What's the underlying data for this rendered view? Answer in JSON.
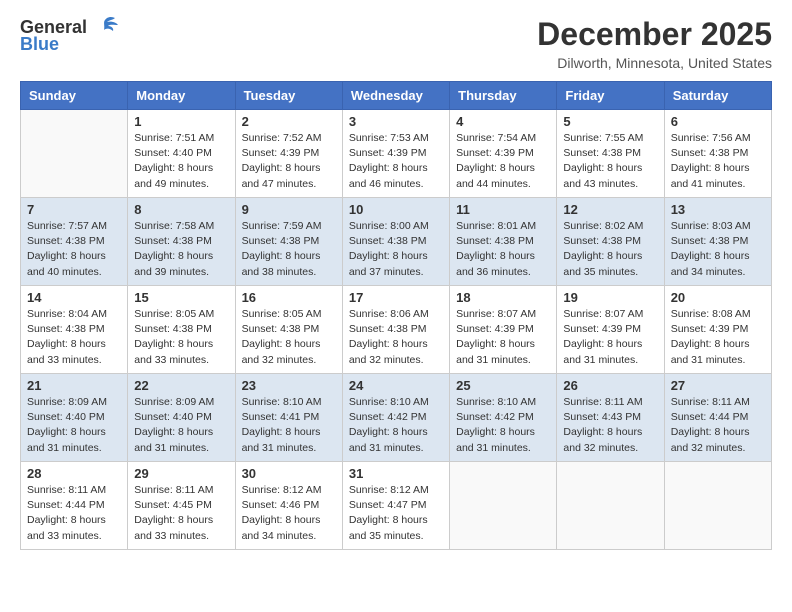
{
  "header": {
    "logo_line1": "General",
    "logo_line2": "Blue",
    "month": "December 2025",
    "location": "Dilworth, Minnesota, United States"
  },
  "days_of_week": [
    "Sunday",
    "Monday",
    "Tuesday",
    "Wednesday",
    "Thursday",
    "Friday",
    "Saturday"
  ],
  "weeks": [
    [
      {
        "day": "",
        "sunrise": "",
        "sunset": "",
        "daylight": ""
      },
      {
        "day": "1",
        "sunrise": "Sunrise: 7:51 AM",
        "sunset": "Sunset: 4:40 PM",
        "daylight": "Daylight: 8 hours and 49 minutes."
      },
      {
        "day": "2",
        "sunrise": "Sunrise: 7:52 AM",
        "sunset": "Sunset: 4:39 PM",
        "daylight": "Daylight: 8 hours and 47 minutes."
      },
      {
        "day": "3",
        "sunrise": "Sunrise: 7:53 AM",
        "sunset": "Sunset: 4:39 PM",
        "daylight": "Daylight: 8 hours and 46 minutes."
      },
      {
        "day": "4",
        "sunrise": "Sunrise: 7:54 AM",
        "sunset": "Sunset: 4:39 PM",
        "daylight": "Daylight: 8 hours and 44 minutes."
      },
      {
        "day": "5",
        "sunrise": "Sunrise: 7:55 AM",
        "sunset": "Sunset: 4:38 PM",
        "daylight": "Daylight: 8 hours and 43 minutes."
      },
      {
        "day": "6",
        "sunrise": "Sunrise: 7:56 AM",
        "sunset": "Sunset: 4:38 PM",
        "daylight": "Daylight: 8 hours and 41 minutes."
      }
    ],
    [
      {
        "day": "7",
        "sunrise": "Sunrise: 7:57 AM",
        "sunset": "Sunset: 4:38 PM",
        "daylight": "Daylight: 8 hours and 40 minutes."
      },
      {
        "day": "8",
        "sunrise": "Sunrise: 7:58 AM",
        "sunset": "Sunset: 4:38 PM",
        "daylight": "Daylight: 8 hours and 39 minutes."
      },
      {
        "day": "9",
        "sunrise": "Sunrise: 7:59 AM",
        "sunset": "Sunset: 4:38 PM",
        "daylight": "Daylight: 8 hours and 38 minutes."
      },
      {
        "day": "10",
        "sunrise": "Sunrise: 8:00 AM",
        "sunset": "Sunset: 4:38 PM",
        "daylight": "Daylight: 8 hours and 37 minutes."
      },
      {
        "day": "11",
        "sunrise": "Sunrise: 8:01 AM",
        "sunset": "Sunset: 4:38 PM",
        "daylight": "Daylight: 8 hours and 36 minutes."
      },
      {
        "day": "12",
        "sunrise": "Sunrise: 8:02 AM",
        "sunset": "Sunset: 4:38 PM",
        "daylight": "Daylight: 8 hours and 35 minutes."
      },
      {
        "day": "13",
        "sunrise": "Sunrise: 8:03 AM",
        "sunset": "Sunset: 4:38 PM",
        "daylight": "Daylight: 8 hours and 34 minutes."
      }
    ],
    [
      {
        "day": "14",
        "sunrise": "Sunrise: 8:04 AM",
        "sunset": "Sunset: 4:38 PM",
        "daylight": "Daylight: 8 hours and 33 minutes."
      },
      {
        "day": "15",
        "sunrise": "Sunrise: 8:05 AM",
        "sunset": "Sunset: 4:38 PM",
        "daylight": "Daylight: 8 hours and 33 minutes."
      },
      {
        "day": "16",
        "sunrise": "Sunrise: 8:05 AM",
        "sunset": "Sunset: 4:38 PM",
        "daylight": "Daylight: 8 hours and 32 minutes."
      },
      {
        "day": "17",
        "sunrise": "Sunrise: 8:06 AM",
        "sunset": "Sunset: 4:38 PM",
        "daylight": "Daylight: 8 hours and 32 minutes."
      },
      {
        "day": "18",
        "sunrise": "Sunrise: 8:07 AM",
        "sunset": "Sunset: 4:39 PM",
        "daylight": "Daylight: 8 hours and 31 minutes."
      },
      {
        "day": "19",
        "sunrise": "Sunrise: 8:07 AM",
        "sunset": "Sunset: 4:39 PM",
        "daylight": "Daylight: 8 hours and 31 minutes."
      },
      {
        "day": "20",
        "sunrise": "Sunrise: 8:08 AM",
        "sunset": "Sunset: 4:39 PM",
        "daylight": "Daylight: 8 hours and 31 minutes."
      }
    ],
    [
      {
        "day": "21",
        "sunrise": "Sunrise: 8:09 AM",
        "sunset": "Sunset: 4:40 PM",
        "daylight": "Daylight: 8 hours and 31 minutes."
      },
      {
        "day": "22",
        "sunrise": "Sunrise: 8:09 AM",
        "sunset": "Sunset: 4:40 PM",
        "daylight": "Daylight: 8 hours and 31 minutes."
      },
      {
        "day": "23",
        "sunrise": "Sunrise: 8:10 AM",
        "sunset": "Sunset: 4:41 PM",
        "daylight": "Daylight: 8 hours and 31 minutes."
      },
      {
        "day": "24",
        "sunrise": "Sunrise: 8:10 AM",
        "sunset": "Sunset: 4:42 PM",
        "daylight": "Daylight: 8 hours and 31 minutes."
      },
      {
        "day": "25",
        "sunrise": "Sunrise: 8:10 AM",
        "sunset": "Sunset: 4:42 PM",
        "daylight": "Daylight: 8 hours and 31 minutes."
      },
      {
        "day": "26",
        "sunrise": "Sunrise: 8:11 AM",
        "sunset": "Sunset: 4:43 PM",
        "daylight": "Daylight: 8 hours and 32 minutes."
      },
      {
        "day": "27",
        "sunrise": "Sunrise: 8:11 AM",
        "sunset": "Sunset: 4:44 PM",
        "daylight": "Daylight: 8 hours and 32 minutes."
      }
    ],
    [
      {
        "day": "28",
        "sunrise": "Sunrise: 8:11 AM",
        "sunset": "Sunset: 4:44 PM",
        "daylight": "Daylight: 8 hours and 33 minutes."
      },
      {
        "day": "29",
        "sunrise": "Sunrise: 8:11 AM",
        "sunset": "Sunset: 4:45 PM",
        "daylight": "Daylight: 8 hours and 33 minutes."
      },
      {
        "day": "30",
        "sunrise": "Sunrise: 8:12 AM",
        "sunset": "Sunset: 4:46 PM",
        "daylight": "Daylight: 8 hours and 34 minutes."
      },
      {
        "day": "31",
        "sunrise": "Sunrise: 8:12 AM",
        "sunset": "Sunset: 4:47 PM",
        "daylight": "Daylight: 8 hours and 35 minutes."
      },
      {
        "day": "",
        "sunrise": "",
        "sunset": "",
        "daylight": ""
      },
      {
        "day": "",
        "sunrise": "",
        "sunset": "",
        "daylight": ""
      },
      {
        "day": "",
        "sunrise": "",
        "sunset": "",
        "daylight": ""
      }
    ]
  ]
}
